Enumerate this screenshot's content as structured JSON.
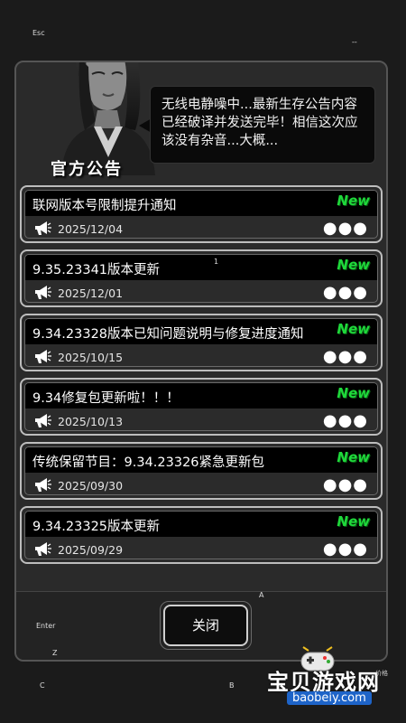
{
  "keyhints": {
    "esc": "Esc",
    "dash": "--",
    "enter": "Enter",
    "z": "Z",
    "c": "C",
    "b": "B",
    "a": "A",
    "one": "1"
  },
  "header": {
    "speech": "无线电静噪中...最新生存公告内容已经破译并发送完毕！相信这次应该没有杂音...大概...",
    "title": "官方公告"
  },
  "announcements": [
    {
      "title": "联网版本号限制提升通知",
      "date": "2025/12/04",
      "badge": "New"
    },
    {
      "title": "9.35.23341版本更新",
      "date": "2025/12/01",
      "badge": "New"
    },
    {
      "title": "9.34.23328版本已知问题说明与修复进度通知",
      "date": "2025/10/15",
      "badge": "New"
    },
    {
      "title": "9.34修复包更新啦！！！",
      "date": "2025/10/13",
      "badge": "New"
    },
    {
      "title": "传统保留节目：9.34.23326紧急更新包",
      "date": "2025/09/30",
      "badge": "New"
    },
    {
      "title": "9.34.23325版本更新",
      "date": "2025/09/29",
      "badge": "New"
    }
  ],
  "more_dots": "●●●",
  "close_label": "关闭",
  "watermark": {
    "text": "宝贝游戏网",
    "url": "baobeiy.com",
    "small": "价格"
  }
}
